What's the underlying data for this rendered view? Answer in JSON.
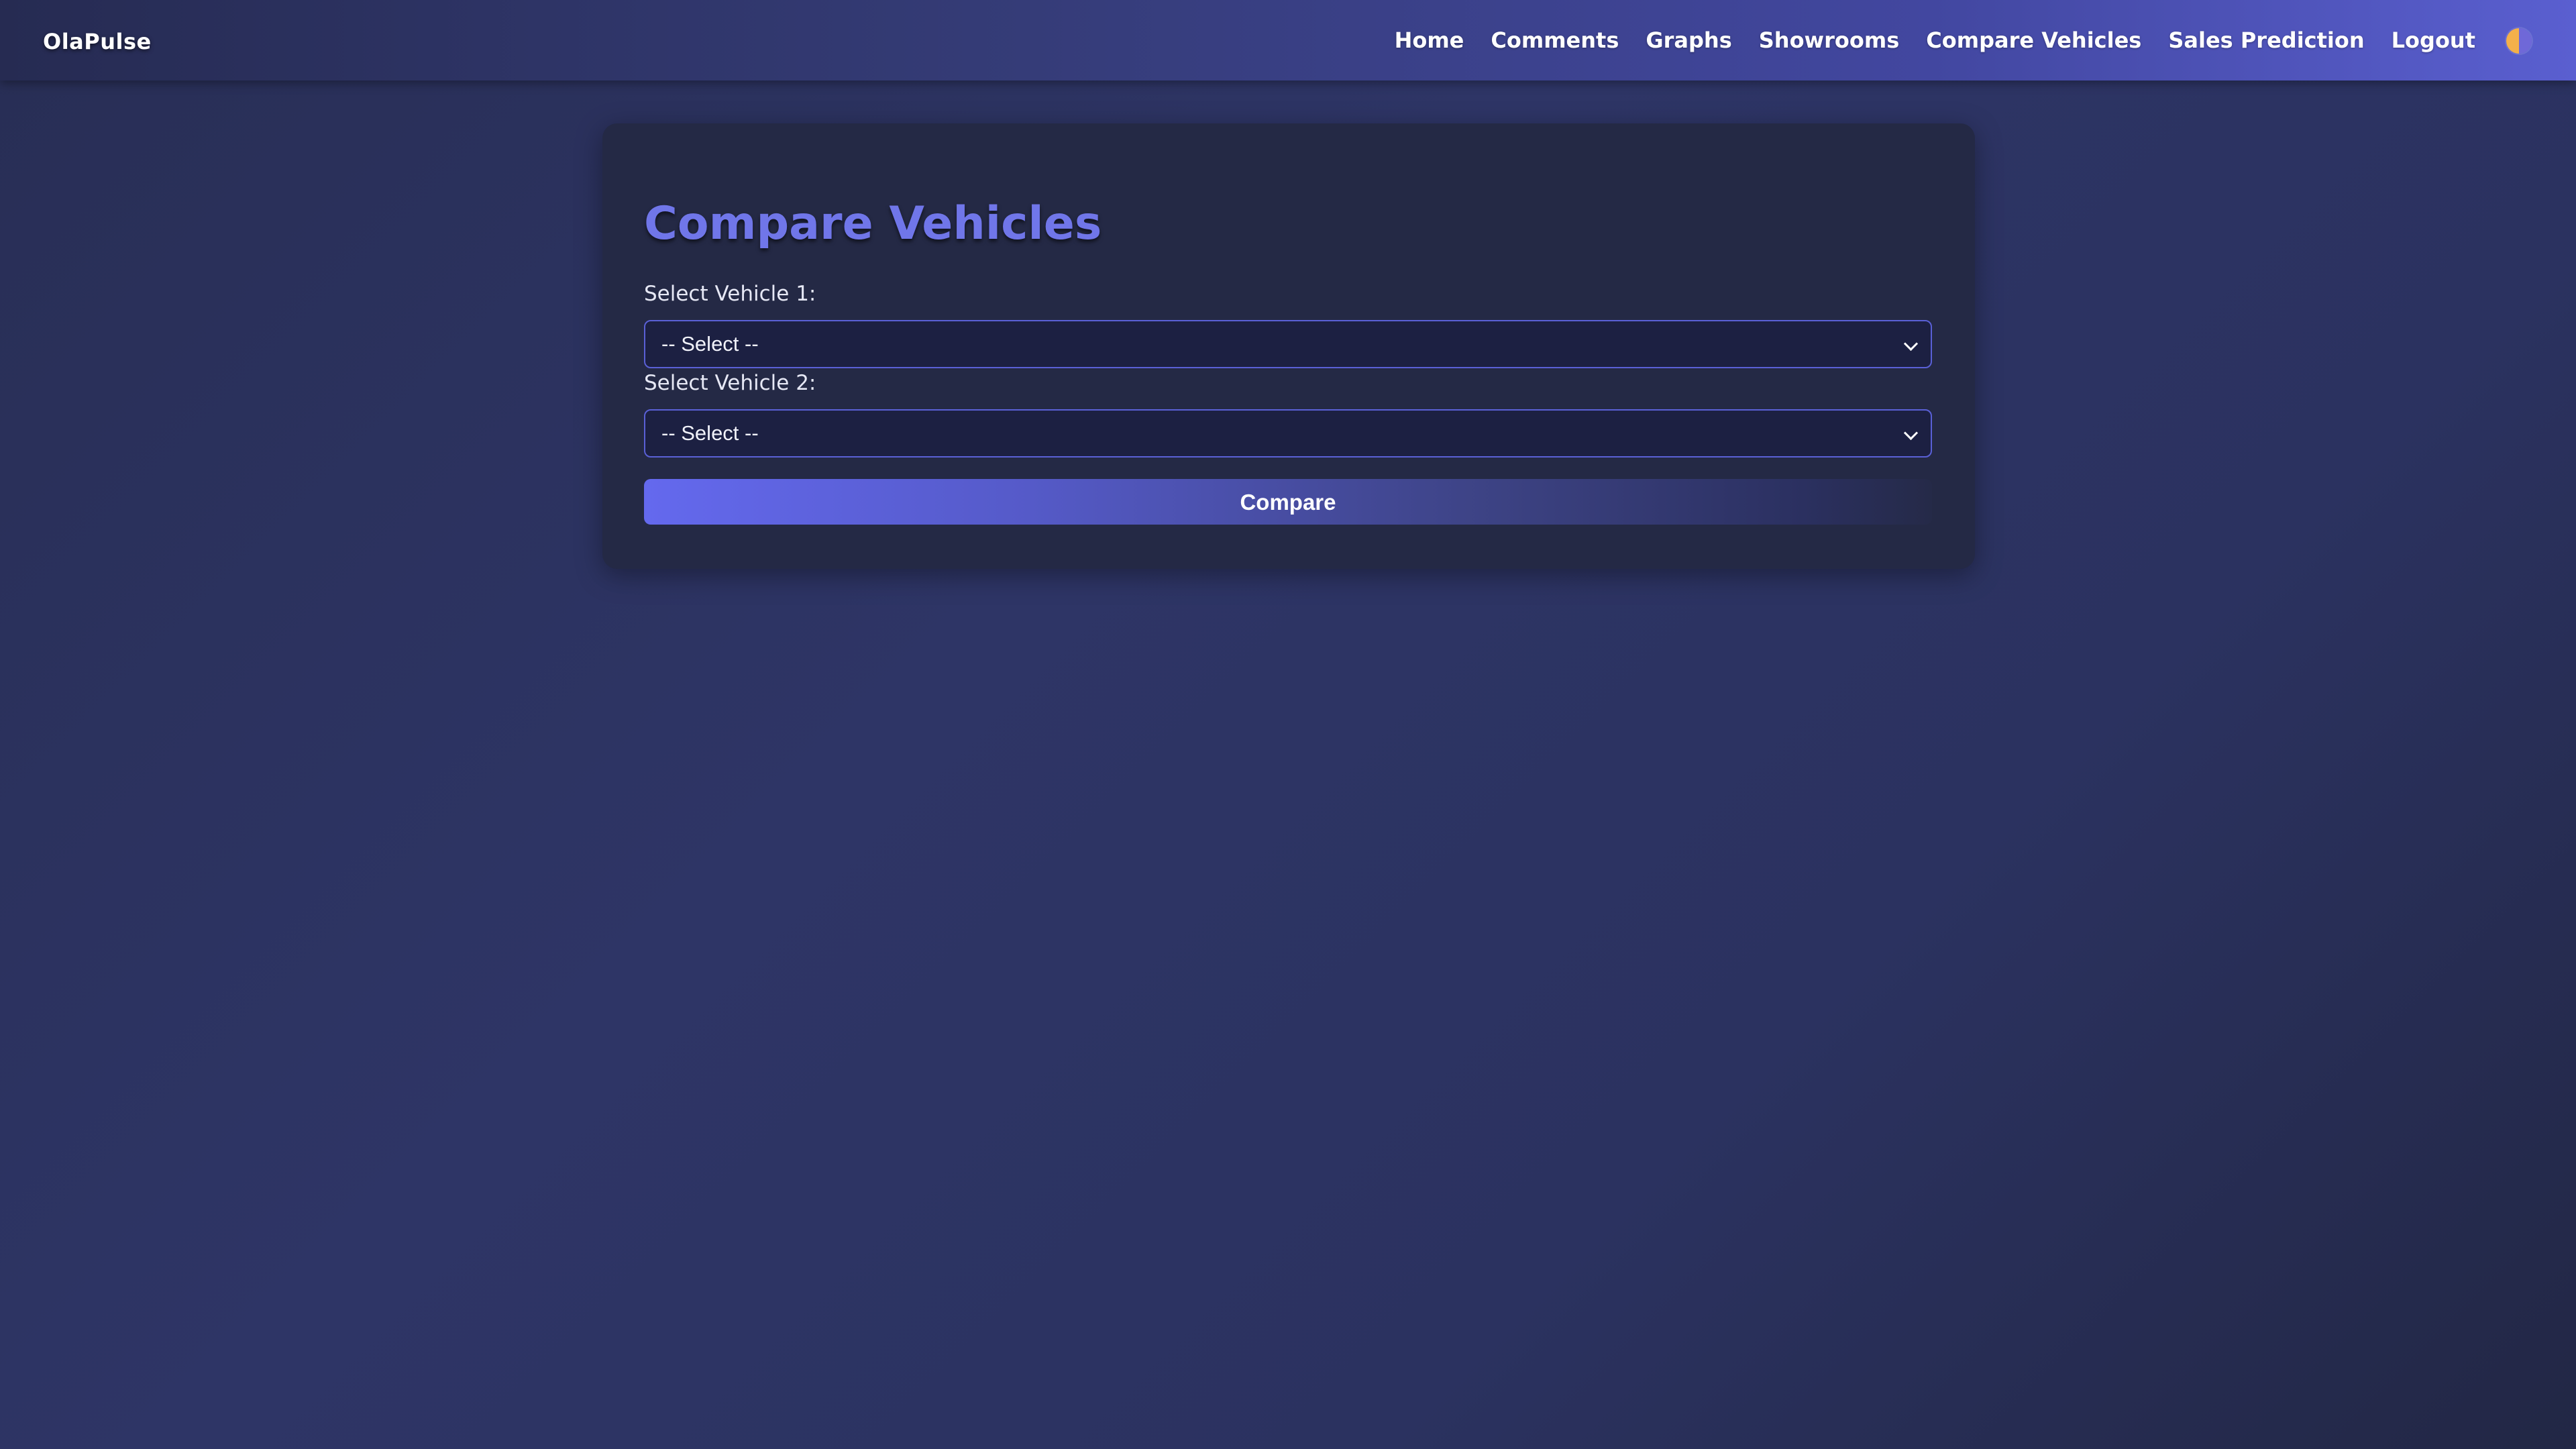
{
  "navbar": {
    "brand": "OlaPulse",
    "links": [
      {
        "label": "Home"
      },
      {
        "label": "Comments"
      },
      {
        "label": "Graphs"
      },
      {
        "label": "Showrooms"
      },
      {
        "label": "Compare Vehicles"
      },
      {
        "label": "Sales Prediction"
      },
      {
        "label": "Logout"
      }
    ],
    "theme_toggle_icon": "half-moon-theme-icon"
  },
  "compare": {
    "title": "Compare Vehicles",
    "vehicle1": {
      "label": "Select Vehicle 1:",
      "selected": "-- Select --"
    },
    "vehicle2": {
      "label": "Select Vehicle 2:",
      "selected": "-- Select --"
    },
    "button_label": "Compare"
  },
  "colors": {
    "accent": "#6469ee",
    "title": "#7076e9",
    "card_bg": "#242945",
    "select_border": "#5a60d6"
  }
}
